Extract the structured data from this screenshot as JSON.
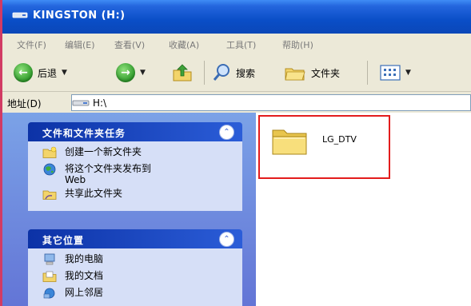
{
  "window": {
    "title": "KINGSTON (H:)",
    "frame_color": "#d23b64",
    "titlebar_color": "#0b4ec7"
  },
  "menubar": {
    "items": [
      "文件(F)",
      "编辑(E)",
      "查看(V)",
      "收藏(A)",
      "工具(T)",
      "帮助(H)"
    ]
  },
  "toolbar": {
    "back_label": "后退",
    "search_label": "搜索",
    "folders_label": "文件夹"
  },
  "address": {
    "label": "地址(D)",
    "value": "H:\\"
  },
  "tasks_panel": {
    "title": "文件和文件夹任务",
    "items": [
      {
        "icon": "new-folder-icon",
        "line1": "创建一个新文件夹",
        "line2": ""
      },
      {
        "icon": "globe-icon",
        "line1": "将这个文件夹发布到",
        "line2": "Web"
      },
      {
        "icon": "share-folder-icon",
        "line1": "共享此文件夹",
        "line2": ""
      }
    ]
  },
  "places_panel": {
    "title": "其它位置",
    "items": [
      {
        "icon": "my-computer-icon",
        "label": "我的电脑"
      },
      {
        "icon": "my-documents-icon",
        "label": "我的文档"
      },
      {
        "icon": "network-places-icon",
        "label": "网上邻居"
      }
    ]
  },
  "content": {
    "items": [
      {
        "name": "LG_DTV",
        "type": "folder",
        "highlight_color": "#e31c1c"
      }
    ]
  }
}
